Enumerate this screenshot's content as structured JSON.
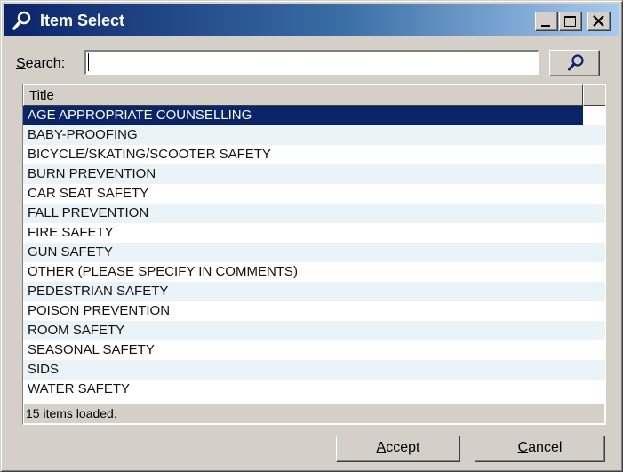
{
  "window": {
    "title": "Item Select",
    "icons": [
      "search-icon",
      "minimize-icon",
      "maximize-icon",
      "close-icon"
    ]
  },
  "search": {
    "label_accel": "S",
    "label_rest": "earch:",
    "value": "",
    "placeholder": ""
  },
  "list": {
    "column_title": "Title",
    "items": [
      "AGE APPROPRIATE COUNSELLING",
      "BABY-PROOFING",
      "BICYCLE/SKATING/SCOOTER SAFETY",
      "BURN PREVENTION",
      "CAR SEAT SAFETY",
      "FALL PREVENTION",
      "FIRE SAFETY",
      "GUN SAFETY",
      "OTHER (PLEASE SPECIFY IN COMMENTS)",
      "PEDESTRIAN SAFETY",
      "POISON PREVENTION",
      "ROOM SAFETY",
      "SEASONAL SAFETY",
      "SIDS",
      "WATER SAFETY"
    ],
    "selected_index": 0,
    "status": "15 items loaded."
  },
  "buttons": {
    "accept_accel": "A",
    "accept_rest": "ccept",
    "cancel_accel": "C",
    "cancel_rest": "ancel"
  },
  "colors": {
    "titlebar_start": "#0a246a",
    "titlebar_end": "#a6caf0",
    "selection": "#0a246a",
    "alt_row": "#eaf4f8",
    "face": "#d4d0c8"
  }
}
